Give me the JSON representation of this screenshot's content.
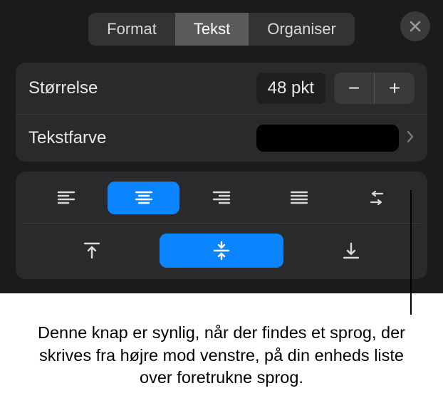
{
  "tabs": {
    "format": "Format",
    "text": "Tekst",
    "organize": "Organiser",
    "active": "text"
  },
  "rows": {
    "size_label": "Størrelse",
    "size_value": "48 pkt",
    "color_label": "Tekstfarve"
  },
  "callout": "Denne knap er synlig, når der findes et sprog, der skrives fra højre mod venstre, på din enheds liste over foretrukne sprog."
}
